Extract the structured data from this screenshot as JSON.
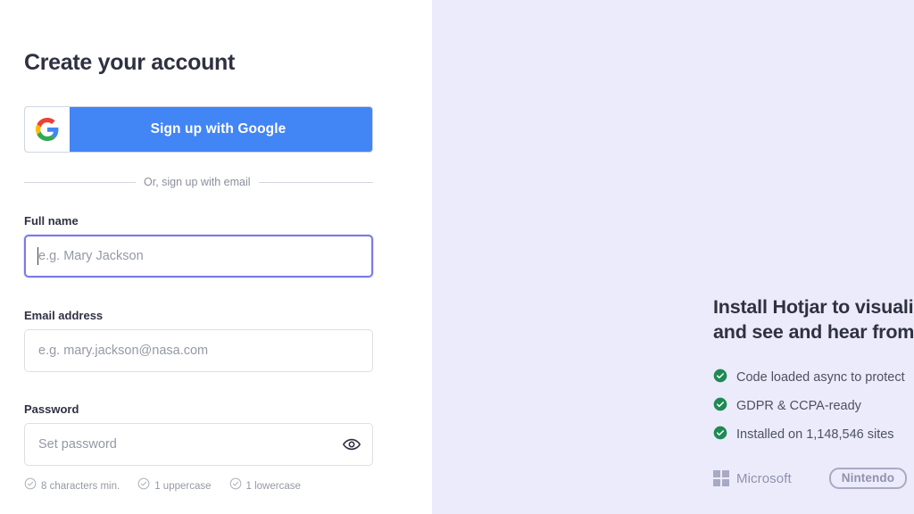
{
  "form": {
    "title": "Create your account",
    "google_button": {
      "label": "Sign up with Google",
      "icon": "google-g-icon",
      "background_color": "#4285F4"
    },
    "divider_text": "Or, sign up with email",
    "fields": [
      {
        "name": "full-name",
        "label": "Full name",
        "placeholder": "e.g. Mary Jackson",
        "value": "",
        "focused": true
      },
      {
        "name": "email-address",
        "label": "Email address",
        "placeholder": "e.g. mary.jackson@nasa.com",
        "value": "",
        "focused": false
      },
      {
        "name": "password",
        "label": "Password",
        "placeholder": "Set password",
        "value": "",
        "focused": false,
        "reveal_icon": "eye-icon"
      }
    ],
    "password_rules": [
      {
        "text": "8 characters min.",
        "icon": "check-circle-outline-icon",
        "met": false
      },
      {
        "text": "1 uppercase",
        "icon": "check-circle-outline-icon",
        "met": false
      },
      {
        "text": "1 lowercase",
        "icon": "check-circle-outline-icon",
        "met": false
      }
    ],
    "focus_ring_color": "#7B79E8"
  },
  "promo": {
    "heading_line1": "Install Hotjar to visualize",
    "heading_line2": "and see and hear from",
    "background_color": "#EBEBFB",
    "benefits": [
      {
        "text": "Code loaded async to protect",
        "icon": "check-circle-filled-icon"
      },
      {
        "text": "GDPR & CCPA-ready",
        "icon": "check-circle-filled-icon"
      },
      {
        "text": "Installed on 1,148,546 sites",
        "icon": "check-circle-filled-icon"
      }
    ],
    "check_color": "#1E8A54",
    "logos": [
      {
        "name": "Microsoft",
        "icon": "microsoft-squares-icon"
      },
      {
        "name": "Nintendo",
        "icon": "nintendo-wordmark-icon"
      }
    ]
  }
}
